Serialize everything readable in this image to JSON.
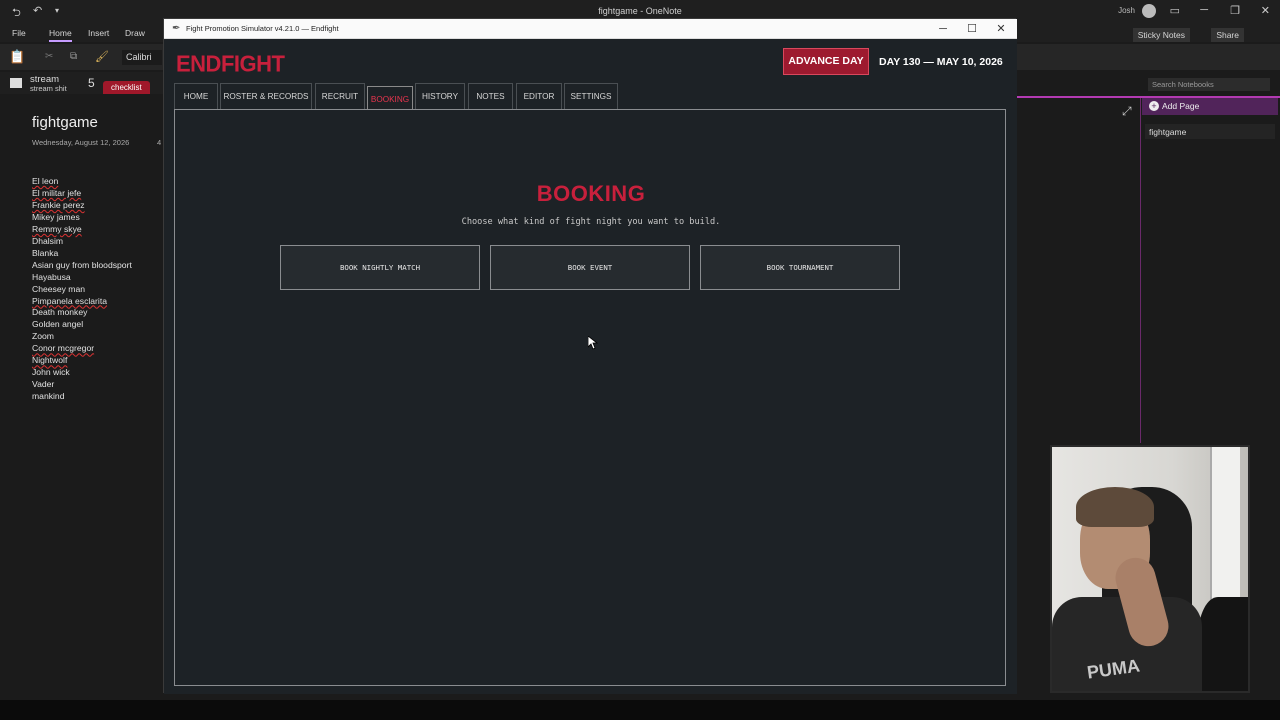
{
  "onenote": {
    "window_title": "fightgame - OneNote",
    "user": "Josh",
    "ribbon_tabs": [
      "File",
      "Home",
      "Insert",
      "Draw"
    ],
    "font_name": "Calibri",
    "sticky_notes": "Sticky Notes",
    "share": "Share",
    "section": {
      "title": "stream",
      "subtitle": "stream shit",
      "badge": "5",
      "tab": "checklist"
    },
    "page_title": "fightgame",
    "page_date": "Wednesday, August 12, 2026",
    "page_time": "4",
    "list": [
      "El leon",
      "El militar jefe",
      "Frankie perez",
      "Mikey james",
      "Remmy skye",
      "Dhalsim",
      "Blanka",
      "Asian guy from bloodsport",
      "Hayabusa",
      "Cheesey man",
      "Pimpanela esclarita",
      "Death monkey",
      "Golden angel",
      "Zoom",
      "Conor mcgregor",
      "Nightwolf",
      "John wick",
      "Vader",
      "mankind"
    ],
    "search_placeholder": "Search Notebooks",
    "add_page": "Add Page",
    "page_item": "fightgame"
  },
  "game": {
    "window_title": "Fight Promotion Simulator v4.21.0 — Endfight",
    "logo": "ENDFIGHT",
    "advance_day": "ADVANCE DAY",
    "day_label": "DAY 130 — MAY 10, 2026",
    "tabs": [
      "HOME",
      "ROSTER & RECORDS",
      "RECRUIT",
      "BOOKING",
      "HISTORY",
      "NOTES",
      "EDITOR",
      "SETTINGS"
    ],
    "active_tab": "BOOKING",
    "heading": "BOOKING",
    "subtitle": "Choose what kind of fight night you want to build.",
    "buttons": [
      "BOOK NIGHTLY MATCH",
      "BOOK EVENT",
      "BOOK TOURNAMENT"
    ]
  },
  "colors": {
    "accent": "#c8203c",
    "advance_bg": "#9d1a2f",
    "panel_bg": "#1d2226"
  }
}
